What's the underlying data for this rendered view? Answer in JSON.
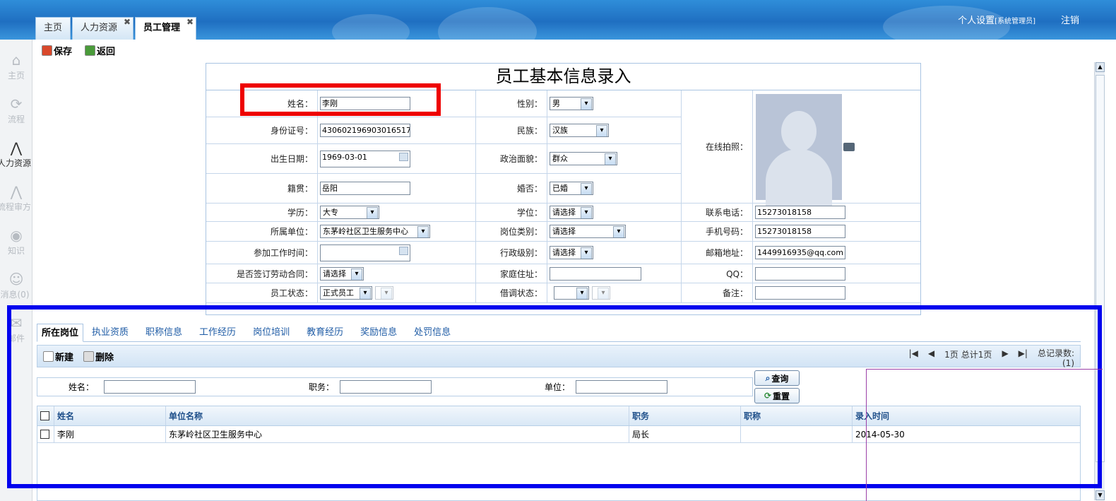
{
  "header": {
    "tabs": [
      {
        "label": "主页",
        "closable": false,
        "active": false
      },
      {
        "label": "人力资源",
        "closable": true,
        "active": false
      },
      {
        "label": "员工管理",
        "closable": true,
        "active": true
      }
    ],
    "settings_label": "个人设置",
    "settings_role": "[系统管理员]",
    "logout_label": "注销",
    "close_glyph": "✖"
  },
  "sidebar": {
    "items": [
      {
        "label": "主页",
        "icon": "home-icon",
        "glyph": "⌂",
        "active": false
      },
      {
        "label": "流程",
        "icon": "flow-icon",
        "glyph": "⟳",
        "active": false
      },
      {
        "label": "人力资源",
        "icon": "hr-icon",
        "glyph": "⋀",
        "active": true
      },
      {
        "label": "流程审方",
        "icon": "approve-icon",
        "glyph": "⋀",
        "active": false
      },
      {
        "label": "知识",
        "icon": "knowledge-icon",
        "glyph": "◉",
        "active": false
      },
      {
        "label": "消息(0)",
        "icon": "message-icon",
        "glyph": "☺",
        "active": false
      },
      {
        "label": "邮件",
        "icon": "mail-icon",
        "glyph": "✉",
        "active": false
      }
    ]
  },
  "toolbar": {
    "save_label": "保存",
    "back_label": "返回"
  },
  "form": {
    "title": "员工基本信息录入",
    "name_label": "姓名：",
    "name_value": "李刚",
    "gender_label": "性别：",
    "gender_value": "男",
    "photo_label": "在线拍照：",
    "id_label": "身份证号：",
    "id_value": "430602196903016517",
    "ethnicity_label": "民族：",
    "ethnicity_value": "汉族",
    "birth_label": "出生日期：",
    "birth_value": "1969-03-01",
    "politics_label": "政治面貌：",
    "politics_value": "群众",
    "hometown_label": "籍贯：",
    "hometown_value": "岳阳",
    "marital_label": "婚否：",
    "marital_value": "已婚",
    "education_label": "学历：",
    "education_value": "大专",
    "degree_label": "学位：",
    "degree_value": "请选择",
    "phone_label": "联系电话：",
    "phone_value": "15273018158",
    "unit_label": "所属单位：",
    "unit_value": "东茅岭社区卫生服务中心",
    "post_type_label": "岗位类别：",
    "post_type_value": "请选择",
    "mobile_label": "手机号码：",
    "mobile_value": "15273018158",
    "work_start_label": "参加工作时间：",
    "work_start_value": "",
    "admin_level_label": "行政级别：",
    "admin_level_value": "请选择",
    "email_label": "邮箱地址：",
    "email_value": "1449916935@qq.com",
    "contract_label": "是否签订劳动合同：",
    "contract_value": "请选择",
    "address_label": "家庭住址：",
    "address_value": "",
    "qq_label": "QQ：",
    "qq_value": "",
    "status_label": "员工状态：",
    "status_value": "正式员工",
    "secondment_label": "借调状态：",
    "secondment_value": "",
    "remark_label": "备注：",
    "remark_value": ""
  },
  "bottom": {
    "tabs": [
      "所在岗位",
      "执业资质",
      "职称信息",
      "工作经历",
      "岗位培训",
      "教育经历",
      "奖励信息",
      "处罚信息"
    ],
    "active_tab": "所在岗位",
    "new_label": "新建",
    "delete_label": "删除",
    "pager": {
      "page_text": "1页",
      "total_pages_text": "总计1页",
      "total_label": "总记录数:",
      "total_count": "(1)"
    },
    "search": {
      "name_label": "姓名：",
      "duty_label": "职务：",
      "unit_label": "单位："
    },
    "query_label": "查询",
    "reset_label": "重置",
    "columns": [
      "姓名",
      "单位名称",
      "职务",
      "职称",
      "录入时间"
    ],
    "rows": [
      {
        "name": "李刚",
        "unit": "东茅岭社区卫生服务中心",
        "duty": "局长",
        "title": "",
        "date": "2014-05-30"
      }
    ]
  },
  "annotations": {
    "red": "#ee0000",
    "blue": "#0000ee",
    "purple": "#9b3fa8"
  }
}
